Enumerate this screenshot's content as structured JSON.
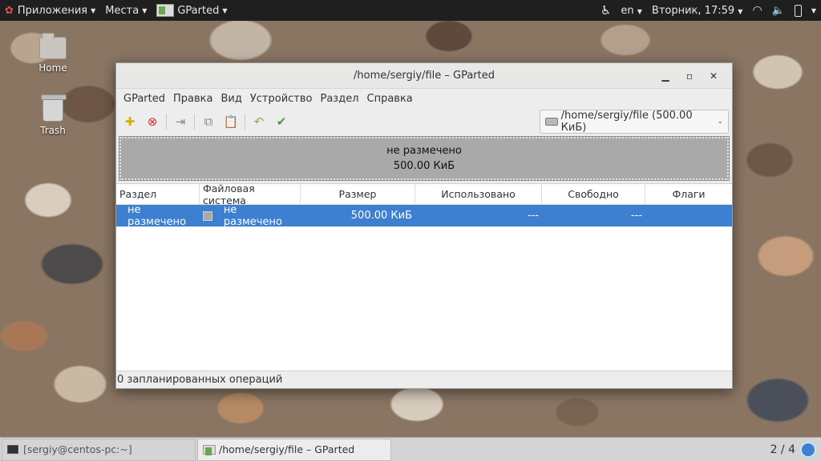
{
  "topbar": {
    "apps_label": "Приложения",
    "places_label": "Места",
    "active_app": "GParted",
    "lang": "en",
    "clock": "Вторник, 17:59"
  },
  "desktop": {
    "icons": [
      {
        "label": "Home"
      },
      {
        "label": "Trash"
      }
    ]
  },
  "window": {
    "title": "/home/sergiy/file – GParted",
    "menu": [
      "GParted",
      "Правка",
      "Вид",
      "Устройство",
      "Раздел",
      "Справка"
    ],
    "device": "/home/sergiy/file  (500.00 КиБ)",
    "diskmap": {
      "label": "не размечено",
      "size": "500.00 КиБ"
    },
    "columns": [
      "Раздел",
      "Файловая система",
      "Размер",
      "Использовано",
      "Свободно",
      "Флаги"
    ],
    "rows": [
      {
        "partition": "не размечено",
        "filesystem": "не размечено",
        "size": "500.00 КиБ",
        "used": "---",
        "free": "---",
        "flags": ""
      }
    ],
    "status": "0 запланированных операций"
  },
  "taskbar": {
    "tasks": [
      "[sergiy@centos-pc:~]",
      "/home/sergiy/file – GParted"
    ],
    "workspace": "2 / 4"
  }
}
